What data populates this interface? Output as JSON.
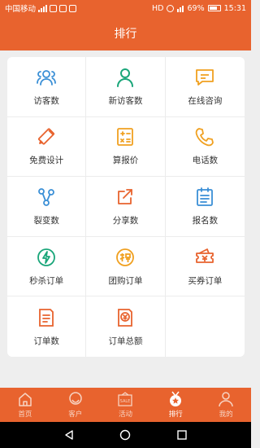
{
  "status_bar": {
    "carrier": "中国移动",
    "network": "HD",
    "battery": "69%",
    "time": "15:31"
  },
  "header": {
    "title": "排行"
  },
  "grid": {
    "items": [
      {
        "label": "访客数",
        "icon": "visitors-icon",
        "color": "#3a8fd6"
      },
      {
        "label": "新访客数",
        "icon": "new-visitor-icon",
        "color": "#1aa67a"
      },
      {
        "label": "在线咨询",
        "icon": "chat-icon",
        "color": "#f0a020"
      },
      {
        "label": "免费设计",
        "icon": "design-icon",
        "color": "#e8632e"
      },
      {
        "label": "算报价",
        "icon": "calculator-icon",
        "color": "#f0a020"
      },
      {
        "label": "电话数",
        "icon": "phone-icon",
        "color": "#f0a020"
      },
      {
        "label": "裂变数",
        "icon": "share-nodes-icon",
        "color": "#3a8fd6"
      },
      {
        "label": "分享数",
        "icon": "share-icon",
        "color": "#e8632e"
      },
      {
        "label": "报名数",
        "icon": "signup-icon",
        "color": "#3a8fd6"
      },
      {
        "label": "秒杀订单",
        "icon": "flash-sale-icon",
        "color": "#1aa67a"
      },
      {
        "label": "团购订单",
        "icon": "group-buy-icon",
        "color": "#f0a020"
      },
      {
        "label": "买券订单",
        "icon": "coupon-icon",
        "color": "#e8632e"
      },
      {
        "label": "订单数",
        "icon": "order-icon",
        "color": "#e8632e"
      },
      {
        "label": "订单总额",
        "icon": "order-total-icon",
        "color": "#e8632e"
      }
    ]
  },
  "tabs": [
    {
      "label": "首页",
      "icon": "home-icon"
    },
    {
      "label": "客户",
      "icon": "customer-icon"
    },
    {
      "label": "活动",
      "icon": "sale-icon",
      "badge": "SALE"
    },
    {
      "label": "排行",
      "icon": "ranking-icon",
      "active": true
    },
    {
      "label": "我的",
      "icon": "profile-icon"
    }
  ]
}
